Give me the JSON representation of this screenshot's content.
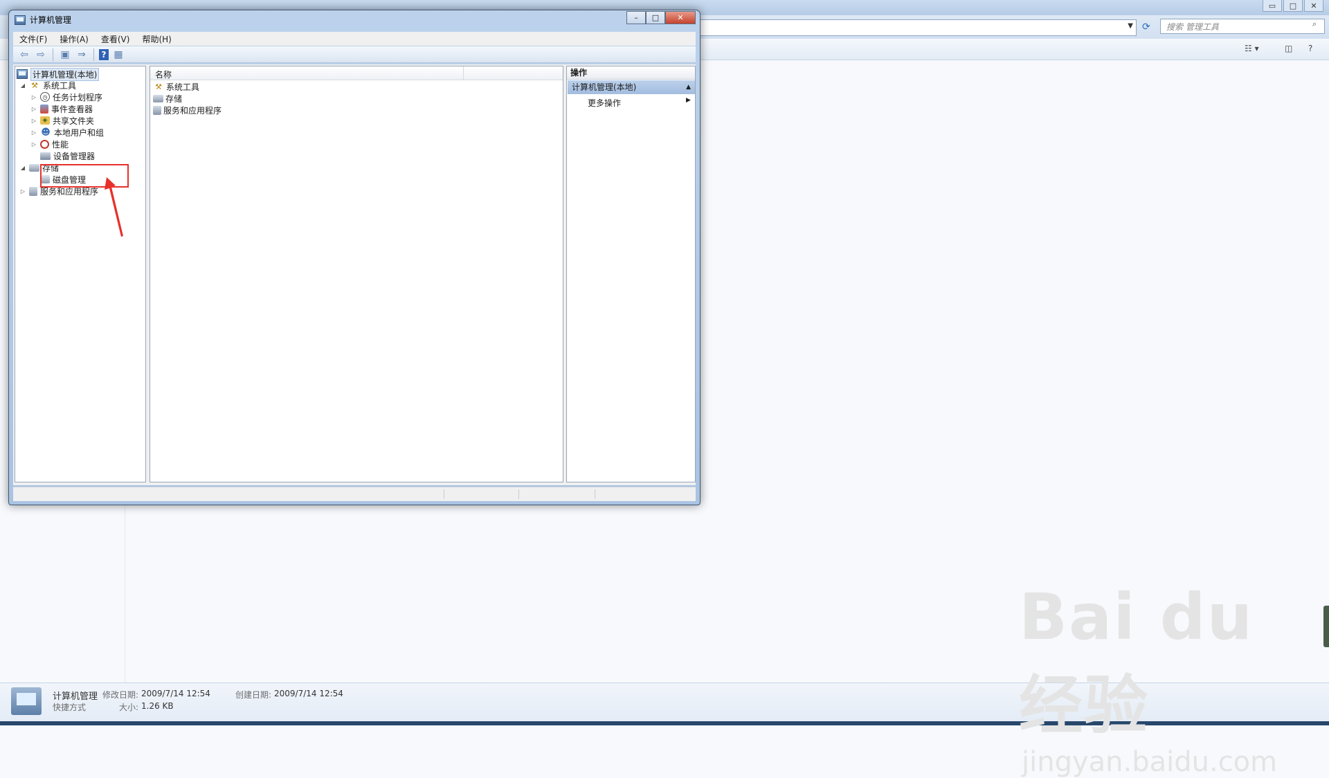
{
  "background_window": {
    "search_placeholder": "搜索 管理工具",
    "caption_buttons": [
      "▭",
      "□",
      "✕"
    ]
  },
  "window": {
    "title": "计算机管理",
    "controls": {
      "minimize": "–",
      "maximize": "□",
      "close": "✕"
    }
  },
  "menu": [
    "文件(F)",
    "操作(A)",
    "查看(V)",
    "帮助(H)"
  ],
  "toolbar": {
    "back": "⇦",
    "forward": "⇨",
    "up": "▣",
    "export": "⇒",
    "help": "?",
    "props": "▦"
  },
  "tree": {
    "root": "计算机管理(本地)",
    "system_tools": "系统工具",
    "task_scheduler": "任务计划程序",
    "event_viewer": "事件查看器",
    "shared_folders": "共享文件夹",
    "local_users": "本地用户和组",
    "performance": "性能",
    "device_manager": "设备管理器",
    "storage": "存储",
    "disk_management": "磁盘管理",
    "services_apps": "服务和应用程序"
  },
  "list": {
    "header_name": "名称",
    "items": [
      "系统工具",
      "存储",
      "服务和应用程序"
    ]
  },
  "actions": {
    "header": "操作",
    "section": "计算机管理(本地)",
    "more": "更多操作"
  },
  "details": {
    "name": "计算机管理",
    "type": "快捷方式",
    "modified_label": "修改日期:",
    "modified_value": "2009/7/14 12:54",
    "created_label": "创建日期:",
    "created_value": "2009/7/14 12:54",
    "size_label": "大小:",
    "size_value": "1.26 KB"
  },
  "watermark": {
    "big": "Bai du 经验",
    "small": "jingyan.baidu.com"
  },
  "colors": {
    "annotation": "#e8302a",
    "selection": "#a2bde0"
  }
}
